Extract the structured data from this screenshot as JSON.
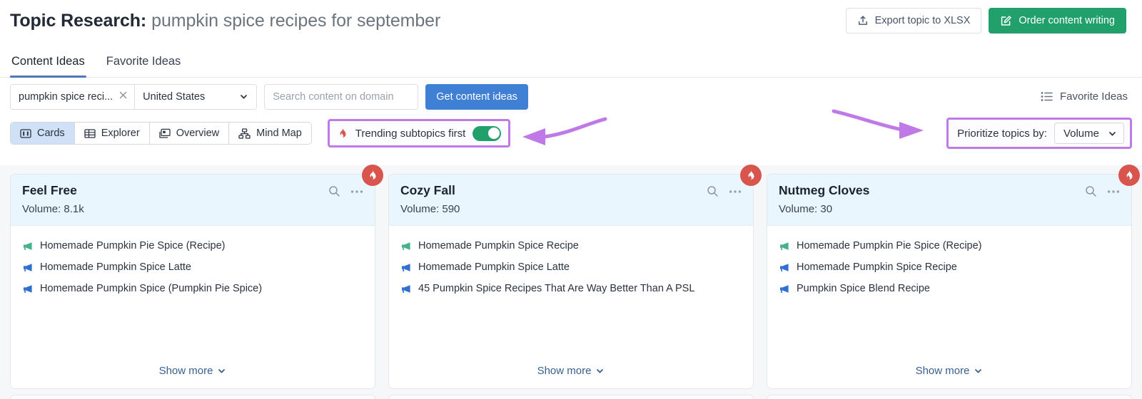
{
  "header": {
    "title_prefix": "Topic Research:",
    "keyword": "pumpkin spice recipes for september",
    "export_button": "Export topic to XLSX",
    "order_button": "Order content writing"
  },
  "tabs": [
    {
      "label": "Content Ideas",
      "active": true
    },
    {
      "label": "Favorite Ideas",
      "active": false
    }
  ],
  "filterbar": {
    "keyword_value": "pumpkin spice reci...",
    "country_value": "United States",
    "domain_placeholder": "Search content on domain",
    "domain_value": "",
    "get_ideas_button": "Get content ideas",
    "favorite_ideas_link": "Favorite Ideas"
  },
  "toolbar": {
    "views": [
      {
        "label": "Cards",
        "icon": "cards-icon",
        "active": true
      },
      {
        "label": "Explorer",
        "icon": "table-icon",
        "active": false
      },
      {
        "label": "Overview",
        "icon": "overview-icon",
        "active": false
      },
      {
        "label": "Mind Map",
        "icon": "mindmap-icon",
        "active": false
      }
    ],
    "trending_label": "Trending subtopics first",
    "trending_on": true,
    "prioritize_label": "Prioritize topics by:",
    "prioritize_value": "Volume",
    "highlight_color": "#c07ae8",
    "toggle_on_color": "#22a06b"
  },
  "cards": [
    {
      "title": "Feel Free",
      "volume_label": "Volume: 8.1k",
      "trending": true,
      "show_more": "Show more",
      "ideas": [
        {
          "text": "Homemade Pumpkin Pie Spice (Recipe)",
          "color": "green"
        },
        {
          "text": "Homemade Pumpkin Spice Latte",
          "color": "blue"
        },
        {
          "text": "Homemade Pumpkin Spice (Pumpkin Pie Spice)",
          "color": "blue"
        }
      ]
    },
    {
      "title": "Cozy Fall",
      "volume_label": "Volume: 590",
      "trending": true,
      "show_more": "Show more",
      "ideas": [
        {
          "text": "Homemade Pumpkin Spice Recipe",
          "color": "green"
        },
        {
          "text": "Homemade Pumpkin Spice Latte",
          "color": "blue"
        },
        {
          "text": "45 Pumpkin Spice Recipes That Are Way Better Than A PSL",
          "color": "blue"
        }
      ]
    },
    {
      "title": "Nutmeg Cloves",
      "volume_label": "Volume: 30",
      "trending": true,
      "show_more": "Show more",
      "ideas": [
        {
          "text": "Homemade Pumpkin Pie Spice (Recipe)",
          "color": "green"
        },
        {
          "text": "Homemade Pumpkin Spice Recipe",
          "color": "blue"
        },
        {
          "text": "Pumpkin Spice Blend Recipe",
          "color": "blue"
        }
      ]
    }
  ],
  "colors": {
    "accent_green": "#22a06b",
    "accent_blue": "#3f7fd4",
    "flame_badge": "#d9544d",
    "card_header_bg": "#eaf6fd",
    "idea_green": "#45b08a",
    "idea_blue": "#2f6fd0"
  }
}
